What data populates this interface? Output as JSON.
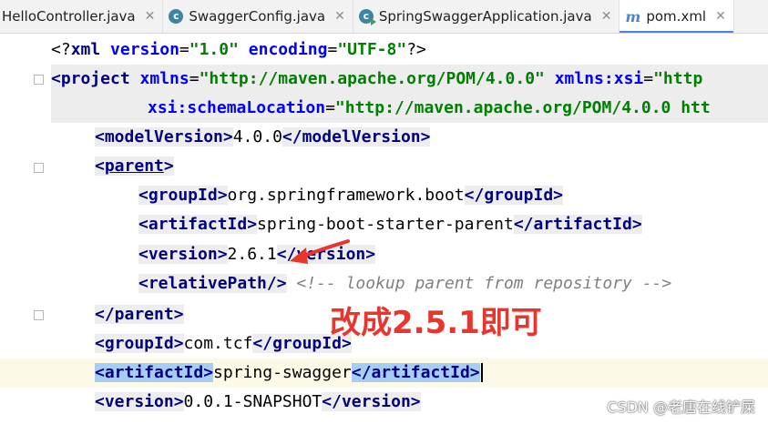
{
  "tabs": [
    {
      "label": "HelloController.java",
      "icon": "class-icon",
      "active": false
    },
    {
      "label": "SwaggerConfig.java",
      "icon": "class-icon",
      "active": false
    },
    {
      "label": "SpringSwaggerApplication.java",
      "icon": "run-class-icon",
      "active": false
    },
    {
      "label": "pom.xml",
      "icon": "maven-icon",
      "active": true
    }
  ],
  "code": {
    "l1": {
      "p1": "<?",
      "p2": "xml ",
      "p3": "version",
      "p4": "=",
      "p5": "\"1.0\"",
      "p6": " encoding",
      "p7": "=",
      "p8": "\"UTF-8\"",
      "p9": "?>"
    },
    "l2": {
      "p1": "<project ",
      "p2": "xmlns",
      "p3": "=",
      "p4": "\"http://maven.apache.org/POM/4.0.0\"",
      "p5": " xmlns:xsi",
      "p6": "=",
      "p7": "\"http"
    },
    "l3": {
      "p1": "xsi:schemaLocation",
      "p2": "=",
      "p3": "\"http://maven.apache.org/POM/4.0.0 htt"
    },
    "l4": {
      "open": "<modelVersion>",
      "text": "4.0.0",
      "close": "</modelVersion>"
    },
    "l5": {
      "lt": "<",
      "name": "parent",
      "gt": ">"
    },
    "l6": {
      "open": "<groupId>",
      "text": "org.springframework.boot",
      "close": "</groupId>"
    },
    "l7": {
      "open": "<artifactId>",
      "text": "spring-boot-starter-parent",
      "close": "</artifactId>"
    },
    "l8": {
      "open": "<version>",
      "text": "2.6.1",
      "close": "</version>"
    },
    "l9": {
      "tag": "<relativePath/>",
      "comment": " <!-- lookup parent from repository -->"
    },
    "l10": {
      "close": "</parent>"
    },
    "l11": {
      "open": "<groupId>",
      "text": "com.tcf",
      "close": "</groupId>"
    },
    "l12": {
      "open": "<artifactId>",
      "text": "spring-swagger",
      "close": "</artifactId>"
    },
    "l13": {
      "open": "<version>",
      "text": "0.0.1-SNAPSHOT",
      "close": "</version>"
    }
  },
  "annotation": "改成2.5.1即可",
  "watermark": "CSDN @老唐在线铲屎",
  "colors": {
    "annotation": "#e8352d",
    "tag": "#000080",
    "attr": "#0000ff",
    "value": "#008000",
    "comment": "#808080",
    "selection": "#a6cdf3"
  }
}
